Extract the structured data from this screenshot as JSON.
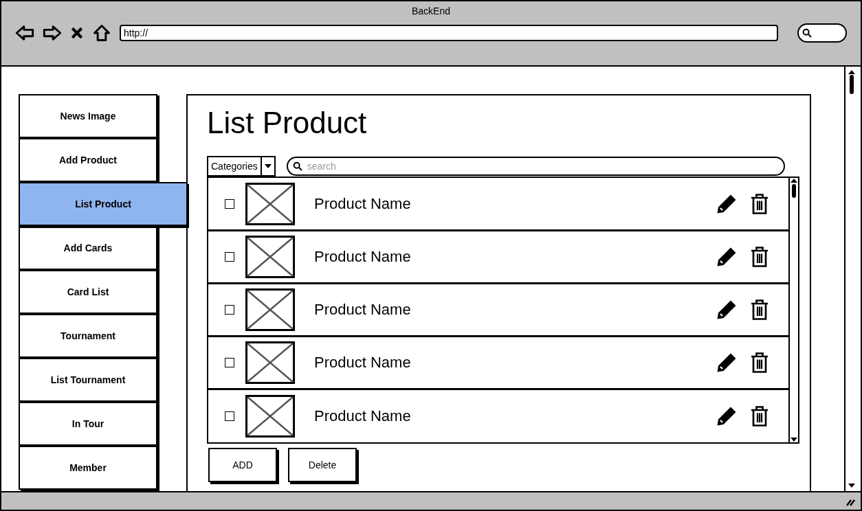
{
  "window": {
    "title": "BackEnd",
    "url": "http://"
  },
  "sidebar": {
    "items": [
      {
        "label": "News Image",
        "selected": false
      },
      {
        "label": "Add Product",
        "selected": false
      },
      {
        "label": "List Product",
        "selected": true
      },
      {
        "label": "Add Cards",
        "selected": false
      },
      {
        "label": "Card List",
        "selected": false
      },
      {
        "label": "Tournament",
        "selected": false
      },
      {
        "label": "List Tournament",
        "selected": false
      },
      {
        "label": "In Tour",
        "selected": false
      },
      {
        "label": "Member",
        "selected": false
      }
    ]
  },
  "page": {
    "title": "List Product",
    "category_filter": "Categories",
    "search": {
      "placeholder": "search"
    },
    "products": [
      {
        "name": "Product Name",
        "checked": false
      },
      {
        "name": "Product Name",
        "checked": false
      },
      {
        "name": "Product Name",
        "checked": false
      },
      {
        "name": "Product Name",
        "checked": false
      },
      {
        "name": "Product Name",
        "checked": false
      }
    ],
    "buttons": [
      "ADD",
      "Delete"
    ]
  }
}
